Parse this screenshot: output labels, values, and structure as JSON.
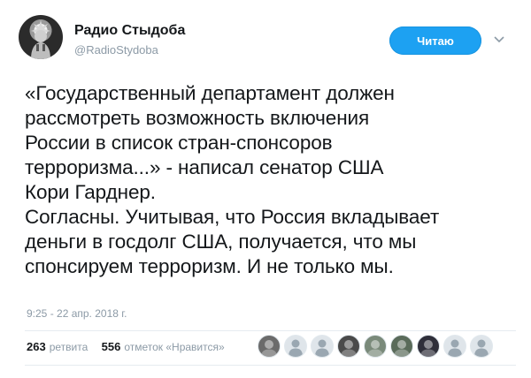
{
  "account": {
    "display_name": "Радио Стыдоба",
    "handle": "@RadioStydoba"
  },
  "follow_button": {
    "label": "Читаю"
  },
  "tweet": {
    "lines": [
      "«Государственный департамент должен",
      "рассмотреть возможность включения",
      "России в список стран-спонсоров",
      "терроризма...» - написал сенатор США",
      "Кори Гарднер.",
      "Согласны. Учитывая, что Россия вкладывает",
      "деньги в госдолг США, получается, что мы",
      "спонсируем терроризм. И не только мы."
    ],
    "timestamp": "9:25 - 22 апр. 2018 г."
  },
  "stats": {
    "retweets_count": "263",
    "retweets_label": "ретвита",
    "likes_count": "556",
    "likes_label": "отметок «Нравится»"
  },
  "likers": [
    {
      "icon": "user-avatar-icon",
      "color": "#6b6b6b"
    },
    {
      "icon": "default-egg-avatar-icon",
      "color": "#9aa7b1"
    },
    {
      "icon": "default-egg-avatar-icon",
      "color": "#9aa7b1"
    },
    {
      "icon": "user-avatar-icon",
      "color": "#4a4a4a"
    },
    {
      "icon": "user-avatar-icon",
      "color": "#7a8a7a"
    },
    {
      "icon": "user-avatar-icon",
      "color": "#5a6b5a"
    },
    {
      "icon": "user-avatar-icon",
      "color": "#2f2f3a"
    },
    {
      "icon": "default-egg-avatar-icon",
      "color": "#9aa7b1"
    },
    {
      "icon": "default-egg-avatar-icon",
      "color": "#9aa7b1"
    }
  ]
}
